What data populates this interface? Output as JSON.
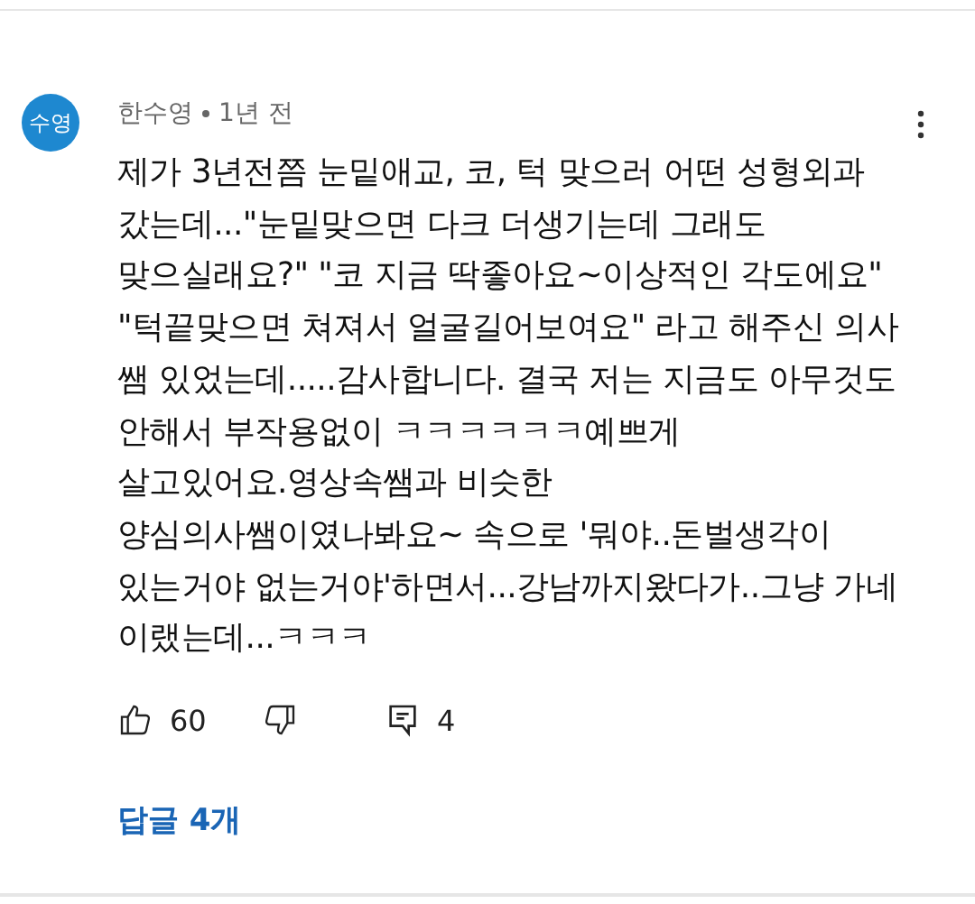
{
  "comment": {
    "avatar": "수영",
    "author": "한수영",
    "time": "1년 전",
    "body_lines": [
      "제가 3년전쯤 눈밑애교, 코, 턱 맞으러 어떤 성형외과",
      "갔는데...\"눈밑맞으면 다크 더생기는데 그래도",
      "맞으실래요?\" \"코 지금 딱좋아요~이상적인 각도에요\"",
      "\"턱끝맞으면 쳐져서 얼굴길어보여요\" 라고 해주신 의사",
      "쌤 있었는데.....감사합니다. 결국 저는 지금도 아무것도",
      "안해서 부작용없이 ㅋㅋㅋㅋㅋㅋ예쁘게",
      "살고있어요.영상속쌤과 비슷한",
      "양심의사쌤이였나봐요~ 속으로 '뭐야..돈벌생각이",
      "있는거야 없는거야'하면서...강남까지왔다가..그냥 가네",
      "이랬는데...ㅋㅋㅋ"
    ],
    "likes": "60",
    "reply_count": "4",
    "replies_link": "답글 4개"
  }
}
